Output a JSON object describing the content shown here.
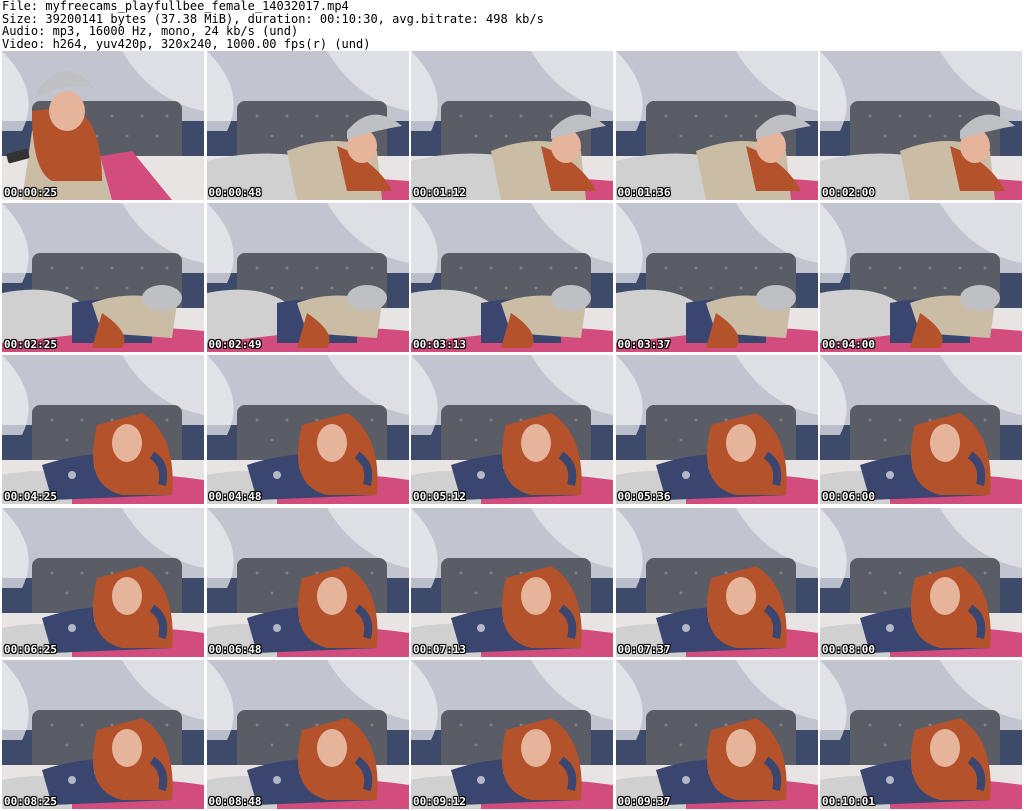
{
  "header": {
    "file": "File: myfreecams_playfullbee_female_14032017.mp4",
    "size": "Size: 39200141 bytes (37.38 MiB), duration: 00:10:30, avg.bitrate: 498 kb/s",
    "audio": "Audio: mp3, 16000 Hz, mono, 24 kb/s (und)",
    "video": "Video: h264, yuv420p, 320x240, 1000.00 fps(r) (und)"
  },
  "thumbnails": [
    {
      "timestamp": "00:00:25",
      "scene": "sitting-phone"
    },
    {
      "timestamp": "00:00:48",
      "scene": "lying-hat"
    },
    {
      "timestamp": "00:01:12",
      "scene": "lying-hat"
    },
    {
      "timestamp": "00:01:36",
      "scene": "lying-hat"
    },
    {
      "timestamp": "00:02:00",
      "scene": "lying-hat"
    },
    {
      "timestamp": "00:02:25",
      "scene": "lying-back"
    },
    {
      "timestamp": "00:02:49",
      "scene": "lying-back"
    },
    {
      "timestamp": "00:03:13",
      "scene": "lying-back"
    },
    {
      "timestamp": "00:03:37",
      "scene": "lying-back"
    },
    {
      "timestamp": "00:04:00",
      "scene": "lying-back"
    },
    {
      "timestamp": "00:04:25",
      "scene": "lying-front"
    },
    {
      "timestamp": "00:04:48",
      "scene": "lying-front"
    },
    {
      "timestamp": "00:05:12",
      "scene": "lying-front"
    },
    {
      "timestamp": "00:05:36",
      "scene": "lying-front"
    },
    {
      "timestamp": "00:06:00",
      "scene": "lying-front"
    },
    {
      "timestamp": "00:06:25",
      "scene": "lying-front"
    },
    {
      "timestamp": "00:06:48",
      "scene": "lying-front"
    },
    {
      "timestamp": "00:07:13",
      "scene": "lying-front"
    },
    {
      "timestamp": "00:07:37",
      "scene": "lying-front"
    },
    {
      "timestamp": "00:08:00",
      "scene": "lying-front"
    },
    {
      "timestamp": "00:08:25",
      "scene": "lying-front"
    },
    {
      "timestamp": "00:08:48",
      "scene": "lying-front"
    },
    {
      "timestamp": "00:09:12",
      "scene": "lying-front"
    },
    {
      "timestamp": "00:09:37",
      "scene": "lying-front"
    },
    {
      "timestamp": "00:10:01",
      "scene": "lying-front"
    }
  ],
  "colors": {
    "headboard": "#5a5c66",
    "wallpaper": "#3e4a6a",
    "curtain": "#d9dbe2",
    "pillow": "#d24c7e",
    "hair": "#b4522c",
    "skin": "#e6b49a",
    "hat": "#bfc0c3",
    "jacket": "#cbbca6",
    "top": "#3b4670",
    "pants": "#cfd0cf"
  }
}
